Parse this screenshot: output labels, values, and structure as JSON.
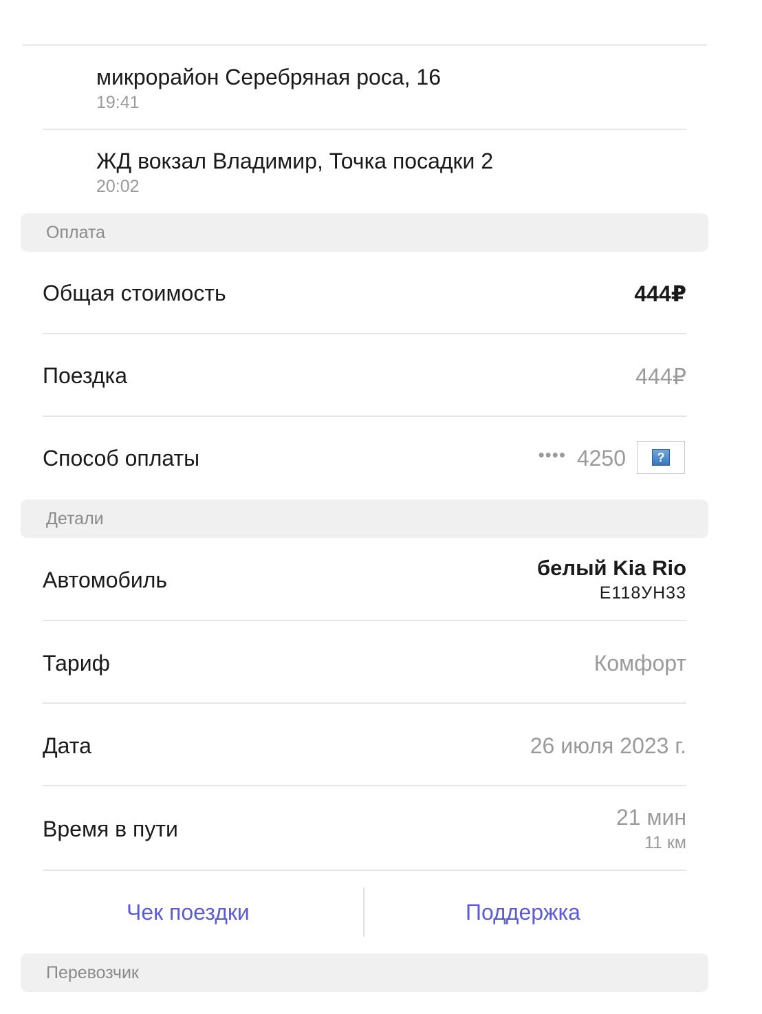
{
  "route": {
    "stops": [
      {
        "address": "микрорайон Серебряная роса, 16",
        "time": "19:41"
      },
      {
        "address": "ЖД вокзал Владимир, Точка посадки 2",
        "time": "20:02"
      }
    ]
  },
  "payment": {
    "header": "Оплата",
    "total_label": "Общая стоимость",
    "total_value": "444₽",
    "ride_label": "Поездка",
    "ride_value": "444₽",
    "method_label": "Способ оплаты",
    "card_dots": "••••",
    "card_last4": "4250",
    "card_icon": "unknown-card-icon",
    "card_icon_glyph": "?"
  },
  "details": {
    "header": "Детали",
    "car_label": "Автомобиль",
    "car_name": "белый Kia Rio",
    "car_plate": "Е118УН33",
    "tariff_label": "Тариф",
    "tariff_value": "Комфорт",
    "date_label": "Дата",
    "date_value": "26 июля 2023 г.",
    "travel_label": "Время в пути",
    "travel_duration": "21 мин",
    "travel_distance": "11 км"
  },
  "actions": {
    "receipt_label": "Чек поездки",
    "support_label": "Поддержка",
    "link_color": "#5b5bd6"
  },
  "carrier": {
    "header": "Перевозчик"
  }
}
